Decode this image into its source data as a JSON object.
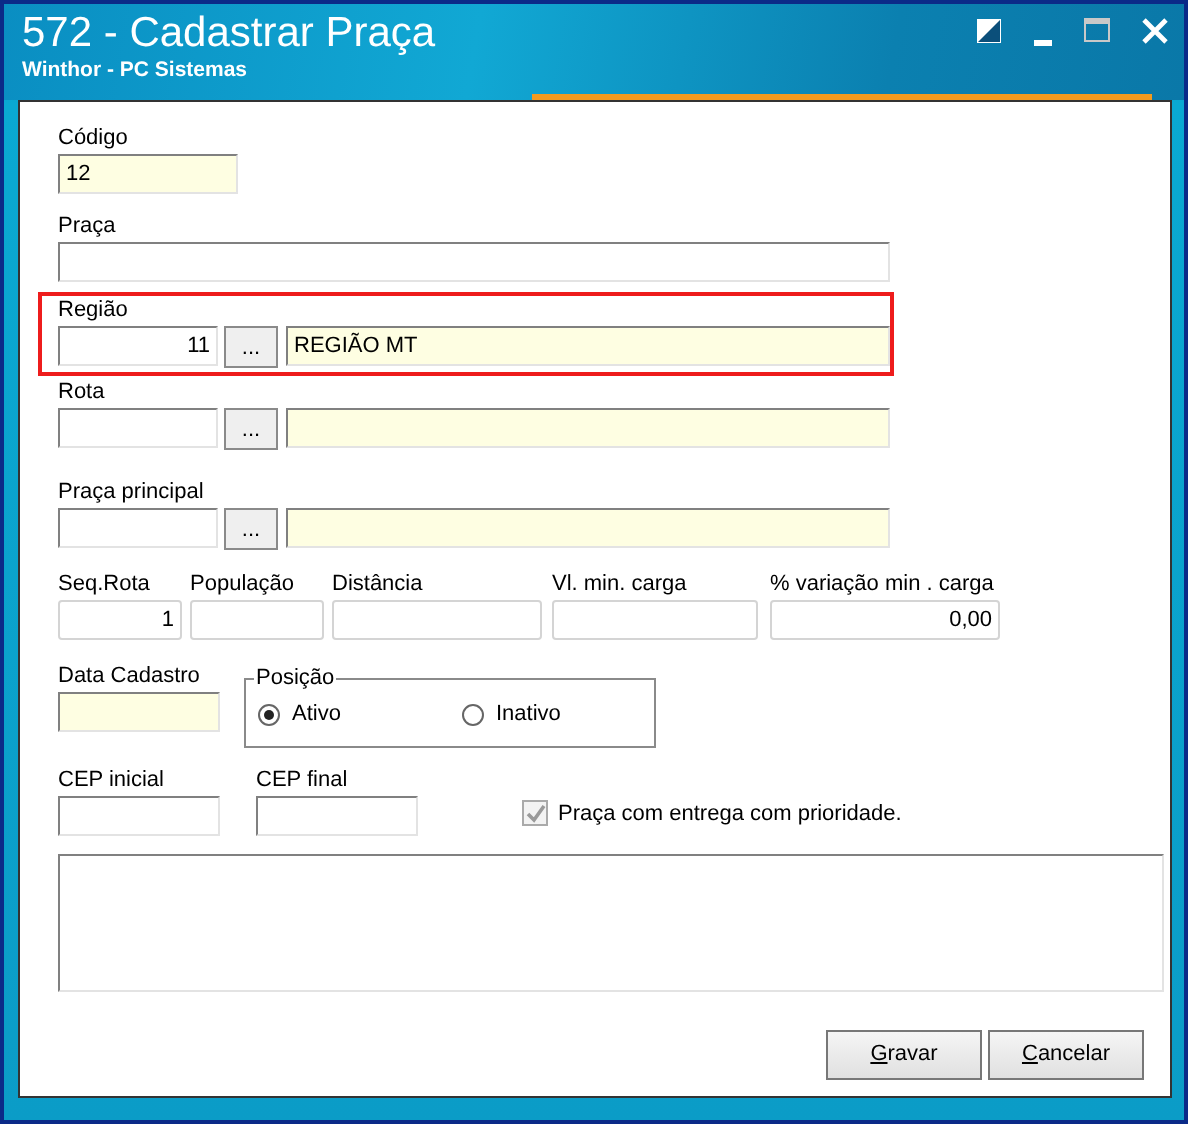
{
  "window": {
    "title": "572 - Cadastrar Praça",
    "subtitle": "Winthor - PC Sistemas"
  },
  "form": {
    "codigo": {
      "label": "Código",
      "value": "12"
    },
    "praca": {
      "label": "Praça"
    },
    "lookups": [
      {
        "label": "Região",
        "code": "11",
        "button": "...",
        "description": "REGIÃO MT",
        "highlighted": true
      },
      {
        "label": "Rota",
        "button": "...",
        "highlighted": false
      },
      {
        "label": "Praça principal",
        "button": "...",
        "highlighted": false
      }
    ],
    "numeric_fields": [
      {
        "label": "Seq.Rota",
        "value": "1"
      },
      {
        "label": "População"
      },
      {
        "label": "Distância"
      },
      {
        "label": "Vl. min. carga"
      },
      {
        "label": "% variação min . carga",
        "value": "0,00"
      }
    ],
    "data_cadastro": {
      "label": "Data Cadastro"
    },
    "posicao": {
      "legend": "Posição",
      "options": [
        {
          "label": "Ativo",
          "selected": true
        },
        {
          "label": "Inativo",
          "selected": false
        }
      ]
    },
    "cep": [
      {
        "label": "CEP inicial"
      },
      {
        "label": "CEP final"
      }
    ],
    "prioridade": {
      "label": "Praça com entrega com prioridade.",
      "checked": true,
      "disabled": true
    }
  },
  "buttons": [
    {
      "label": "Gravar",
      "mnemonic": true
    },
    {
      "label": "Cancelar",
      "mnemonic": true
    }
  ]
}
